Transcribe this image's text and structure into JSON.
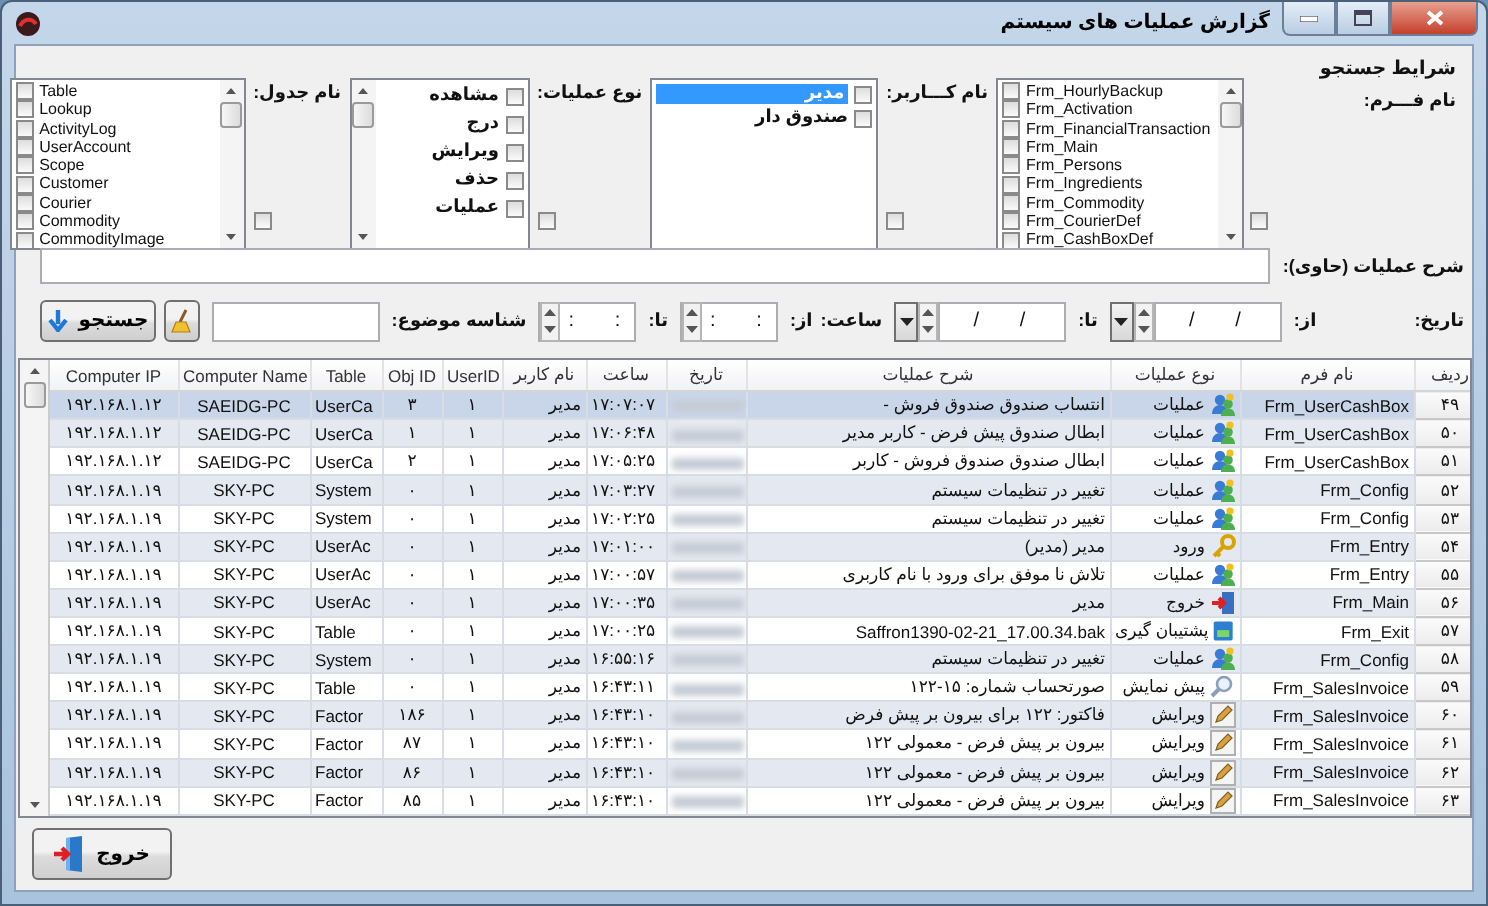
{
  "window": {
    "title": "گزارش عملیات های سیستم"
  },
  "criteria": {
    "title": "شرایط جستجو",
    "filters": [
      {
        "label": "نام فـــرم:",
        "kind": "ltr",
        "scrollable": true,
        "all_checked": false,
        "items": [
          {
            "text": "Frm_HourlyBackup",
            "checked": false,
            "selected": false
          },
          {
            "text": "Frm_Activation",
            "checked": false,
            "selected": false
          },
          {
            "text": "Frm_FinancialTransaction",
            "checked": false,
            "selected": false
          },
          {
            "text": "Frm_Main",
            "checked": false,
            "selected": false
          },
          {
            "text": "Frm_Persons",
            "checked": false,
            "selected": false
          },
          {
            "text": "Frm_Ingredients",
            "checked": false,
            "selected": false
          },
          {
            "text": "Frm_Commodity",
            "checked": false,
            "selected": false
          },
          {
            "text": "Frm_CourierDef",
            "checked": false,
            "selected": false
          },
          {
            "text": "Frm_CashBoxDef",
            "checked": false,
            "selected": false
          }
        ]
      },
      {
        "label": "نام کـــاربر:",
        "kind": "rtl",
        "scrollable": false,
        "all_checked": false,
        "items": [
          {
            "text": "مدیر",
            "checked": false,
            "selected": true
          },
          {
            "text": "صندوق دار",
            "checked": false,
            "selected": false
          }
        ]
      },
      {
        "label": "نوع عملیات:",
        "kind": "rtl",
        "scrollable": true,
        "all_checked": false,
        "items": [
          {
            "text": "مشاهده",
            "checked": false,
            "selected": false
          },
          {
            "text": "درج",
            "checked": false,
            "selected": false
          },
          {
            "text": "ویرایش",
            "checked": false,
            "selected": false
          },
          {
            "text": "حذف",
            "checked": false,
            "selected": false
          },
          {
            "text": "عملیات",
            "checked": false,
            "selected": false
          }
        ]
      },
      {
        "label": "نام جدول:",
        "kind": "ltr",
        "scrollable": true,
        "all_checked": false,
        "items": [
          {
            "text": "Table",
            "checked": false,
            "selected": false
          },
          {
            "text": "Lookup",
            "checked": false,
            "selected": false
          },
          {
            "text": "ActivityLog",
            "checked": false,
            "selected": false
          },
          {
            "text": "UserAccount",
            "checked": false,
            "selected": false
          },
          {
            "text": "Scope",
            "checked": false,
            "selected": false
          },
          {
            "text": "Customer",
            "checked": false,
            "selected": false
          },
          {
            "text": "Courier",
            "checked": false,
            "selected": false
          },
          {
            "text": "Commodity",
            "checked": false,
            "selected": false
          },
          {
            "text": "CommodityImage",
            "checked": false,
            "selected": false
          }
        ]
      }
    ],
    "description": {
      "label": "شرح عملیات (حاوی):"
    },
    "date_filter": {
      "label": "تاریخ:",
      "from_label": "از:",
      "from": "/   /",
      "to_label": "تا:",
      "to": "/   /"
    },
    "time_filter": {
      "label": "ساعت:",
      "from_label": "از:",
      "from": ":   :",
      "to_label": "تا:",
      "to": ":   :"
    },
    "subject_id": {
      "label": "شناسه موضوع:"
    },
    "search_button": {
      "label": "جستجو"
    }
  },
  "table": {
    "columns": [
      "ردیف",
      "نام فرم",
      "نوع عملیات",
      "شرح عملیات",
      "تاریخ",
      "ساعت",
      "نام کاربر",
      "UserID",
      "Obj ID",
      "Table",
      "Computer Name",
      "Computer IP"
    ],
    "rows": [
      {
        "row_number": "۴۹",
        "form": "Frm_UserCashBox",
        "kind": "operations",
        "op_type": "عملیات",
        "description": "انتساب صندوق صندوق فروش -",
        "time": "۱۷:۰۷:۰۷",
        "user": "مدیر",
        "user_id": "۱",
        "obj_id": "۳",
        "table": "UserCa",
        "computer_name": "SAEIDG-PC",
        "computer_ip": "۱۹۲.۱۶۸.۱.۱۲",
        "selected": true
      },
      {
        "row_number": "۵۰",
        "form": "Frm_UserCashBox",
        "kind": "operations",
        "op_type": "عملیات",
        "description": "ابطال صندوق پیش فرض - کاربر مدیر",
        "time": "۱۷:۰۶:۴۸",
        "user": "مدیر",
        "user_id": "۱",
        "obj_id": "۱",
        "table": "UserCa",
        "computer_name": "SAEIDG-PC",
        "computer_ip": "۱۹۲.۱۶۸.۱.۱۲",
        "selected": false
      },
      {
        "row_number": "۵۱",
        "form": "Frm_UserCashBox",
        "kind": "operations",
        "op_type": "عملیات",
        "description": "ابطال صندوق صندوق فروش - کاربر",
        "time": "۱۷:۰۵:۲۵",
        "user": "مدیر",
        "user_id": "۱",
        "obj_id": "۲",
        "table": "UserCa",
        "computer_name": "SAEIDG-PC",
        "computer_ip": "۱۹۲.۱۶۸.۱.۱۲",
        "selected": false
      },
      {
        "row_number": "۵۲",
        "form": "Frm_Config",
        "kind": "operations",
        "op_type": "عملیات",
        "description": "تغییر در تنظیمات سیستم",
        "time": "۱۷:۰۳:۲۷",
        "user": "مدیر",
        "user_id": "۱",
        "obj_id": "۰",
        "table": "System",
        "computer_name": "SKY-PC",
        "computer_ip": "۱۹۲.۱۶۸.۱.۱۹",
        "selected": false
      },
      {
        "row_number": "۵۳",
        "form": "Frm_Config",
        "kind": "operations",
        "op_type": "عملیات",
        "description": "تغییر در تنظیمات سیستم",
        "time": "۱۷:۰۲:۲۵",
        "user": "مدیر",
        "user_id": "۱",
        "obj_id": "۰",
        "table": "System",
        "computer_name": "SKY-PC",
        "computer_ip": "۱۹۲.۱۶۸.۱.۱۹",
        "selected": false
      },
      {
        "row_number": "۵۴",
        "form": "Frm_Entry",
        "kind": "login",
        "op_type": "ورود",
        "description": "مدیر (مدیر)",
        "time": "۱۷:۰۱:۰۰",
        "user": "مدیر",
        "user_id": "۱",
        "obj_id": "۰",
        "table": "UserAc",
        "computer_name": "SKY-PC",
        "computer_ip": "۱۹۲.۱۶۸.۱.۱۹",
        "selected": false
      },
      {
        "row_number": "۵۵",
        "form": "Frm_Entry",
        "kind": "operations",
        "op_type": "عملیات",
        "description": "تلاش نا موفق برای ورود با نام کاربری",
        "time": "۱۷:۰۰:۵۷",
        "user": "مدیر",
        "user_id": "۱",
        "obj_id": "۰",
        "table": "UserAc",
        "computer_name": "SKY-PC",
        "computer_ip": "۱۹۲.۱۶۸.۱.۱۹",
        "selected": false
      },
      {
        "row_number": "۵۶",
        "form": "Frm_Main",
        "kind": "logout",
        "op_type": "خروج",
        "description": "مدیر",
        "time": "۱۷:۰۰:۳۵",
        "user": "مدیر",
        "user_id": "۱",
        "obj_id": "۰",
        "table": "UserAc",
        "computer_name": "SKY-PC",
        "computer_ip": "۱۹۲.۱۶۸.۱.۱۹",
        "selected": false
      },
      {
        "row_number": "۵۷",
        "form": "Frm_Exit",
        "kind": "backup",
        "op_type": "پشتیبان گیری",
        "description": "Saffron1390-02-21_17.00.34.bak",
        "time": "۱۷:۰۰:۲۵",
        "user": "مدیر",
        "user_id": "۱",
        "obj_id": "۰",
        "table": "Table",
        "computer_name": "SKY-PC",
        "computer_ip": "۱۹۲.۱۶۸.۱.۱۹",
        "selected": false
      },
      {
        "row_number": "۵۸",
        "form": "Frm_Config",
        "kind": "operations",
        "op_type": "عملیات",
        "description": "تغییر در تنظیمات سیستم",
        "time": "۱۶:۵۵:۱۶",
        "user": "مدیر",
        "user_id": "۱",
        "obj_id": "۰",
        "table": "System",
        "computer_name": "SKY-PC",
        "computer_ip": "۱۹۲.۱۶۸.۱.۱۹",
        "selected": false
      },
      {
        "row_number": "۵۹",
        "form": "Frm_SalesInvoice",
        "kind": "preview",
        "op_type": "پیش نمایش",
        "description": "صورتحساب شماره: ۱۵-۱۲۲",
        "time": "۱۶:۴۳:۱۱",
        "user": "مدیر",
        "user_id": "۱",
        "obj_id": "۰",
        "table": "Table",
        "computer_name": "SKY-PC",
        "computer_ip": "۱۹۲.۱۶۸.۱.۱۹",
        "selected": false
      },
      {
        "row_number": "۶۰",
        "form": "Frm_SalesInvoice",
        "kind": "edit",
        "op_type": "ویرایش",
        "description": "فاکتور: ۱۲۲ برای بیرون بر پیش فرض",
        "time": "۱۶:۴۳:۱۰",
        "user": "مدیر",
        "user_id": "۱",
        "obj_id": "۱۸۶",
        "table": "Factor",
        "computer_name": "SKY-PC",
        "computer_ip": "۱۹۲.۱۶۸.۱.۱۹",
        "selected": false
      },
      {
        "row_number": "۶۱",
        "form": "Frm_SalesInvoice",
        "kind": "edit",
        "op_type": "ویرایش",
        "description": "بیرون بر پیش فرض - معمولی ۱۲۲",
        "time": "۱۶:۴۳:۱۰",
        "user": "مدیر",
        "user_id": "۱",
        "obj_id": "۸۷",
        "table": "Factor",
        "computer_name": "SKY-PC",
        "computer_ip": "۱۹۲.۱۶۸.۱.۱۹",
        "selected": false
      },
      {
        "row_number": "۶۲",
        "form": "Frm_SalesInvoice",
        "kind": "edit",
        "op_type": "ویرایش",
        "description": "بیرون بر پیش فرض - معمولی ۱۲۲",
        "time": "۱۶:۴۳:۱۰",
        "user": "مدیر",
        "user_id": "۱",
        "obj_id": "۸۶",
        "table": "Factor",
        "computer_name": "SKY-PC",
        "computer_ip": "۱۹۲.۱۶۸.۱.۱۹",
        "selected": false
      },
      {
        "row_number": "۶۳",
        "form": "Frm_SalesInvoice",
        "kind": "edit",
        "op_type": "ویرایش",
        "description": "بیرون بر پیش فرض - معمولی ۱۲۲",
        "time": "۱۶:۴۳:۱۰",
        "user": "مدیر",
        "user_id": "۱",
        "obj_id": "۸۵",
        "table": "Factor",
        "computer_name": "SKY-PC",
        "computer_ip": "۱۹۲.۱۶۸.۱.۱۹",
        "selected": false
      }
    ]
  },
  "exit_button": {
    "label": "خروج"
  }
}
